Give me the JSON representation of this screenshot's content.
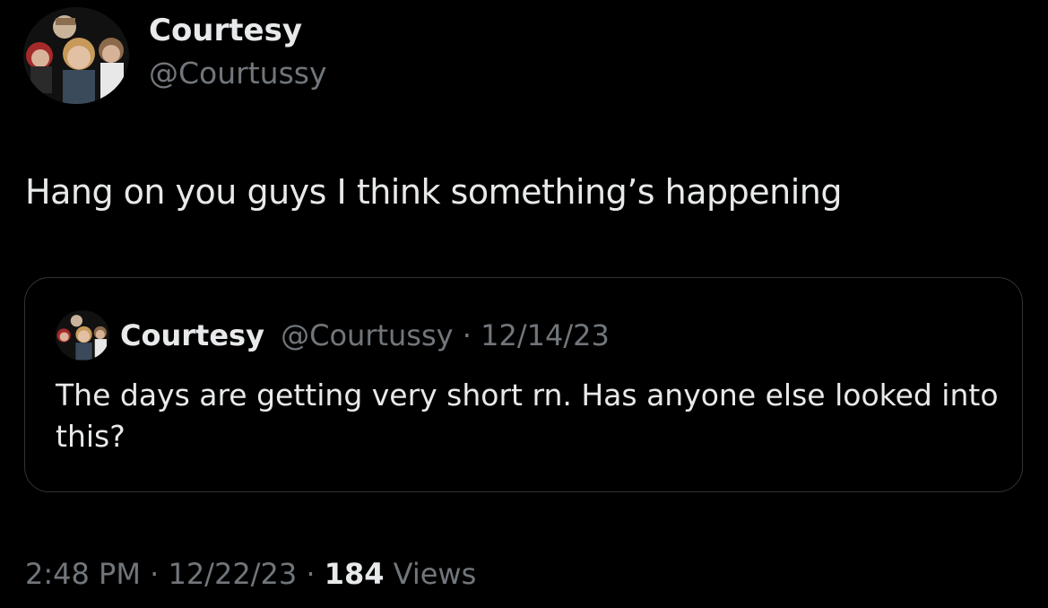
{
  "author": {
    "name": "Courtesy",
    "handle": "@Courtussy"
  },
  "tweet": {
    "text": "Hang on you guys I think something’s happening"
  },
  "quote": {
    "name": "Courtesy",
    "handle": "@Courtussy",
    "separator": " · ",
    "date": "12/14/23",
    "text": "The days are getting very short rn. Has anyone else looked into this?"
  },
  "meta": {
    "time": "2:48 PM",
    "separator1": " · ",
    "date": "12/22/23",
    "separator2": " · ",
    "views_count": "184",
    "views_label": " Views"
  },
  "colors": {
    "background": "#000000",
    "primary_text": "#e7e9ea",
    "secondary_text": "#71767b",
    "border": "#2f3336"
  },
  "icons": {
    "avatar": "group-photo-avatar"
  }
}
